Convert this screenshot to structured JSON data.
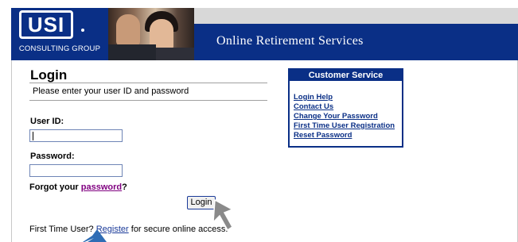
{
  "header": {
    "logo_text": "USI",
    "logo_subtitle": "CONSULTING GROUP",
    "banner_title": "Online Retirement Services"
  },
  "login": {
    "title": "Login",
    "instructions": "Please enter your user ID and password",
    "userid_label": "User ID:",
    "userid_value": "",
    "password_label": "Password:",
    "password_value": "",
    "forgot_prefix": "Forgot your ",
    "forgot_link": "password",
    "forgot_suffix": "?",
    "button_label": "Login",
    "first_time_prefix": "First Time User? ",
    "register_link": "Register",
    "first_time_suffix": " for secure online access."
  },
  "customer_service": {
    "title": "Customer Service",
    "links": [
      "Login Help",
      "Contact Us",
      "Change Your Password",
      "First Time User Registration",
      "Reset Password"
    ]
  },
  "colors": {
    "brand_blue": "#0a2f86",
    "visited_link": "#800080"
  },
  "icons": [
    "mouse-cursor-icon",
    "pointer-arrow-icon"
  ]
}
